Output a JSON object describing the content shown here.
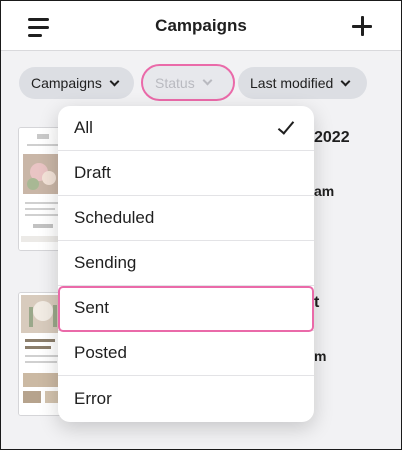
{
  "header": {
    "title": "Campaigns"
  },
  "filters": {
    "campaigns_label": "Campaigns",
    "status_label": "Status",
    "modified_label": "Last modified"
  },
  "background": {
    "card1_title_fragment": "2022",
    "card1_time_fragment": "am",
    "card2_title_fragment": "t",
    "card2_time_fragment": "m"
  },
  "status_menu": {
    "options": [
      "All",
      "Draft",
      "Scheduled",
      "Sending",
      "Sent",
      "Posted",
      "Error"
    ],
    "selected": "All",
    "highlighted": "Sent"
  },
  "colors": {
    "highlight": "#ea6aa9"
  }
}
